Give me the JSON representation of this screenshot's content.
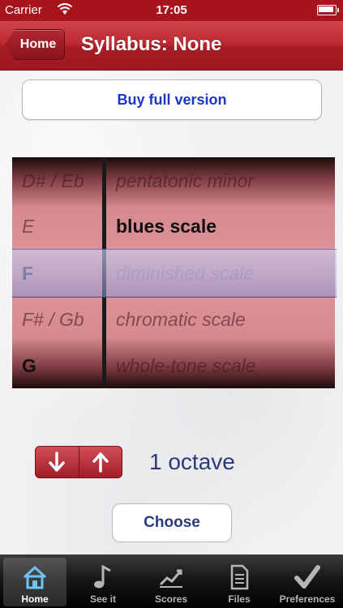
{
  "status_bar": {
    "carrier": "Carrier",
    "time": "17:05"
  },
  "nav": {
    "back_label": "Home",
    "title": "Syllabus: None"
  },
  "buy_button": "Buy full version",
  "picker": {
    "keys": [
      {
        "label": "D# / Eb",
        "style": "dim"
      },
      {
        "label": "E",
        "style": "dim"
      },
      {
        "label": "F",
        "style": "selected"
      },
      {
        "label": "F# / Gb",
        "style": "dim"
      },
      {
        "label": "G",
        "style": "bold"
      }
    ],
    "scales": [
      {
        "label": "pentatonic minor",
        "style": "dim"
      },
      {
        "label": "blues scale",
        "style": "bold"
      },
      {
        "label": "diminished scale",
        "style": "selected"
      },
      {
        "label": "chromatic scale",
        "style": "dim"
      },
      {
        "label": "whole-tone scale",
        "style": "dim"
      }
    ]
  },
  "octave": {
    "down_icon": "arrow-down-icon",
    "up_icon": "arrow-up-icon",
    "label": "1 octave"
  },
  "choose_button": "Choose",
  "tabs": [
    {
      "label": "Home",
      "icon": "house-icon",
      "active": true
    },
    {
      "label": "See it",
      "icon": "music-note-icon",
      "active": false
    },
    {
      "label": "Scores",
      "icon": "chart-line-icon",
      "active": false
    },
    {
      "label": "Files",
      "icon": "document-icon",
      "active": false
    },
    {
      "label": "Preferences",
      "icon": "checkmark-icon",
      "active": false
    }
  ],
  "colors": {
    "accent_red": "#a8141c",
    "text_blue": "#2b3a7c",
    "link_blue": "#1936c7"
  }
}
